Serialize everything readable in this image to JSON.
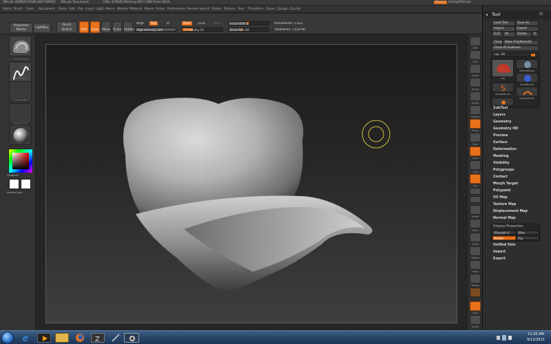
{
  "titlebar": {
    "app": "ZBrush 4[ZBGP-E6HD-AKLT-H8RD]",
    "document": "ZBrush Document",
    "stats": "[Obj: 67840] Memory:467+198 Frees:3620",
    "menus_btn": "Menus",
    "script_btn": "DefaultZScript",
    "minimize": "_",
    "maximize": "□",
    "close": "x"
  },
  "menubar": {
    "items": [
      "Alpha",
      "Brush",
      "Color",
      "Document",
      "Draw",
      "Edit",
      "File",
      "Layer",
      "Light",
      "Macro",
      "Marker",
      "Material",
      "Movie",
      "Picker",
      "Preferences",
      "Render",
      "Stencil",
      "Stroke",
      "Texture",
      "Tool",
      "Transform",
      "Zoom",
      "Zplugin",
      "Zscript"
    ]
  },
  "topshelf": {
    "projection_master": "Projection Master",
    "lightbox": "LightBox",
    "quick_sketch": "Quick Sketch",
    "edit": "Edit",
    "draw": "Draw",
    "move": "Move",
    "scale": "Scale",
    "rotate": "Rotate",
    "mrgb": "Mrgb",
    "rgb": "Rgb",
    "m": "M",
    "zadd": "Zadd",
    "zsub": "Zsub",
    "zcut": "Zcut",
    "focal_shift": "Focal Shift 0",
    "draw_size": "Draw Size 64",
    "rgb_intensity": "Rgb Intensity 100",
    "z_intensity": "Z Intensity 25",
    "active_points": "ActivePoints: 1.623",
    "total_points": "TotalPoints: 1.634 Mil",
    "focal_shift_level": 0.5,
    "draw_size_level": 0.35,
    "rgb_intensity_level": 1,
    "z_intensity_level": 0.25
  },
  "leftshelf": {
    "brush_label": "ClayBuildup",
    "stroke_label": "FreeHand",
    "alpha_label": "Alpha Off",
    "texture_label": "Texture Off",
    "material_label": "",
    "gradient_label": "Gradient",
    "switch_color_label": "SwitchColor"
  },
  "rightstrip": {
    "labels": [
      "BPR",
      "SPix",
      "Scroll",
      "Zoom",
      "Actual",
      "AAHalf",
      "Persp",
      "Floor",
      "Local",
      "L.Sym",
      "Xyz",
      "",
      "",
      "Frame",
      "Move",
      "Scale",
      "Rotate",
      "PolyF",
      "Transp",
      "",
      "",
      "",
      "Solo",
      "Xpose"
    ]
  },
  "toolpanel": {
    "title": "Tool",
    "load_tool": "Load Tool",
    "save_as": "Save As",
    "import": "Import",
    "export": "Export",
    "goz": "GoZ",
    "all": "All",
    "visible": "Visible",
    "r": "R",
    "clone": "Clone",
    "make_polymesh": "Make PolyMesh3D",
    "clone_all": "Clone All Subtools",
    "cap_label": "cap. 48",
    "thumb_labels": [
      "cap",
      "SphereBrush",
      "AlphaBrush",
      "SimpleBrush",
      "EraserBrush",
      ""
    ],
    "items": [
      "SubTool",
      "Layers",
      "Geometry",
      "Geometry HD",
      "Preview",
      "Surface",
      "Deformation",
      "Masking",
      "Visibility",
      "Polygroups",
      "Contact",
      "Morph Target",
      "Polypaint",
      "UV Map",
      "Texture Map",
      "Displacement Map",
      "Normal Map"
    ],
    "display_properties": "Display Properties",
    "dsmooth": "DSmooth 0",
    "dres": "DRes",
    "double": "Double",
    "flip": "Flip",
    "bottom_items": [
      "Unified Skin",
      "Import",
      "Export"
    ]
  },
  "taskbar": {
    "time": "11:05 AM",
    "date": "9/12/2011"
  },
  "colors": {
    "accent": "#e8711c",
    "panel": "#2e2e2e",
    "canvas_top": "#1c1c1c",
    "canvas_bottom": "#3e3e3e"
  }
}
